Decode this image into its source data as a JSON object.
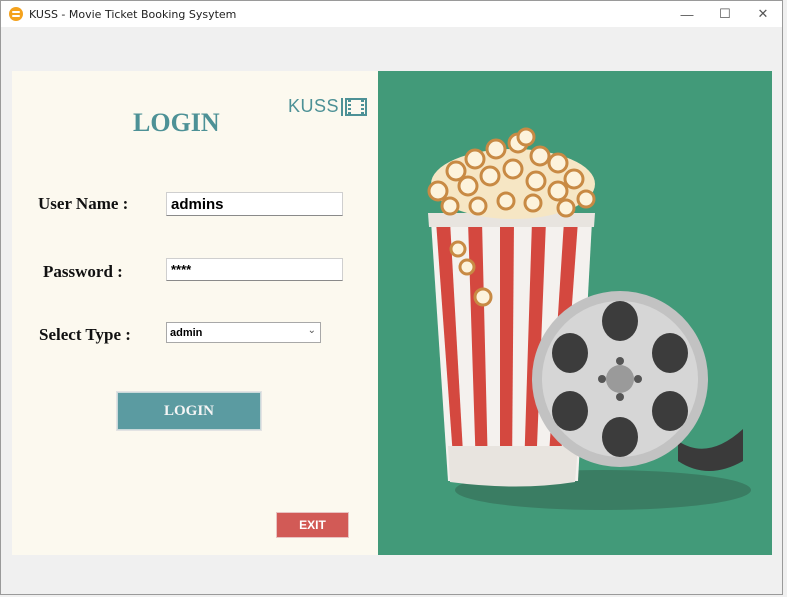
{
  "window": {
    "title": "KUSS - Movie Ticket Booking Sysytem",
    "controls": {
      "minimize": "—",
      "maximize": "☐",
      "close": "✕"
    }
  },
  "left_panel": {
    "heading": "LOGIN",
    "logo_text": "KUSS",
    "username": {
      "label": "User Name :",
      "value": "admins"
    },
    "password": {
      "label": "Password :",
      "value": "****"
    },
    "user_type": {
      "label": "Select Type :",
      "selected": "admin"
    },
    "login_button": "LOGIN",
    "exit_button": "EXIT"
  },
  "right_panel": {
    "illustration": "popcorn-and-film-reel"
  },
  "colors": {
    "accent_teal": "#5b9ba1",
    "panel_green": "#429a79",
    "exit_red": "#d25a56",
    "panel_cream": "#fcf9ef"
  }
}
